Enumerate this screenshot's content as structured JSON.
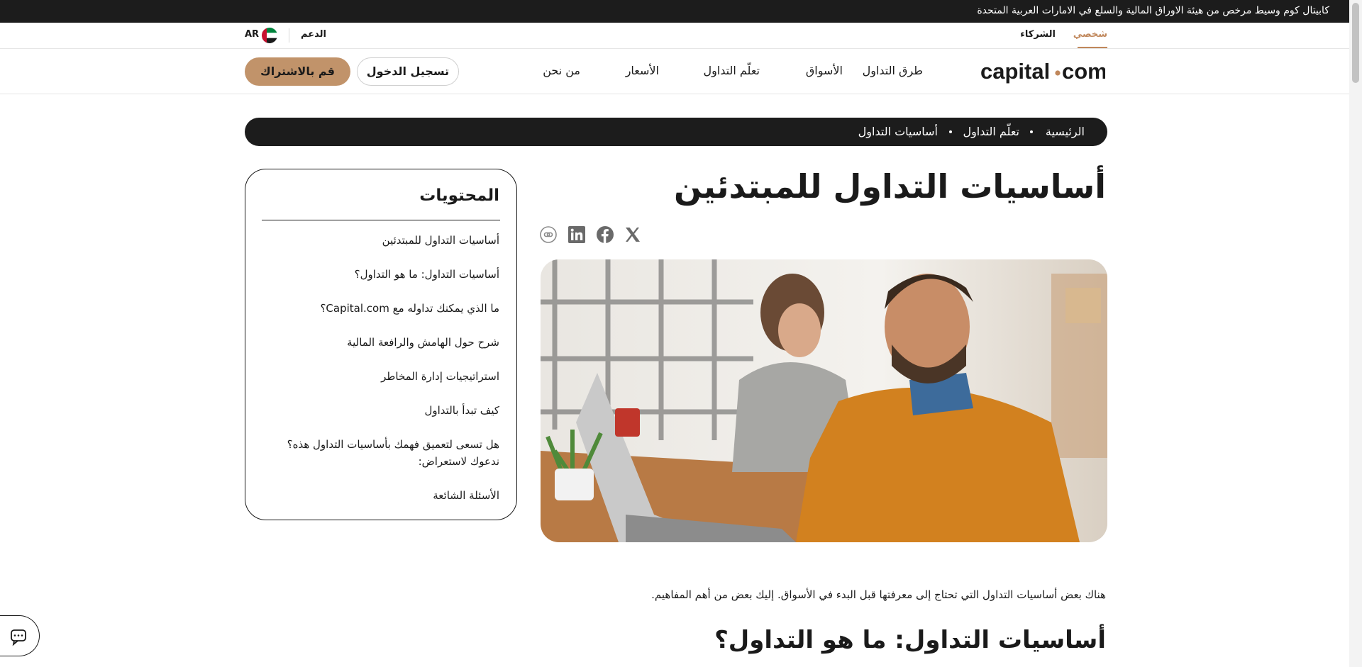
{
  "top_banner": {
    "text": "كابيتال كوم وسيط مرخص من هيئة الاوراق المالية والسلع في الامارات العربية المتحدة"
  },
  "segment_bar": {
    "personal": "شخصي",
    "partners": "الشركاء",
    "support": "الدعم",
    "language": "AR",
    "accent_color": "#c0875b"
  },
  "nav": {
    "logo_text": {
      "left": "capital",
      "right": "com"
    },
    "items": [
      "طرق التداول",
      "الأسواق",
      "تعلّم التداول",
      "الأسعار",
      "من نحن"
    ],
    "login": "تسجيل الدخول",
    "signup": "قم بالاشتراك",
    "signup_color": "#c1936a"
  },
  "breadcrumb": [
    "الرئيسية",
    "تعلّم التداول",
    "أساسيات التداول"
  ],
  "article": {
    "title": "أساسيات التداول للمبتدئين",
    "share_icons": [
      "x-icon",
      "facebook-icon",
      "linkedin-icon",
      "copy-link-icon"
    ],
    "intro": "هناك بعض أساسيات التداول التي تحتاج إلى معرفتها قبل البدء في الأسواق. إليك بعض من أهم المفاهيم.",
    "section_title": "أساسيات التداول: ما هو التداول؟"
  },
  "toc": {
    "title": "المحتويات",
    "items": [
      "أساسيات التداول للمبتدئين",
      "أساسيات التداول: ما هو التداول؟",
      "ما الذي يمكنك تداوله مع Capital.com؟",
      "شرح حول الهامش والرافعة المالية",
      "استراتيجيات إدارة المخاطر",
      "كيف تبدأ بالتداول",
      "هل تسعى لتعميق فهمك بأساسيات التداول هذه؟ ندعوك لاستعراض:",
      "الأسئلة الشائعة"
    ]
  },
  "chat": {
    "icon": "chat-icon"
  }
}
